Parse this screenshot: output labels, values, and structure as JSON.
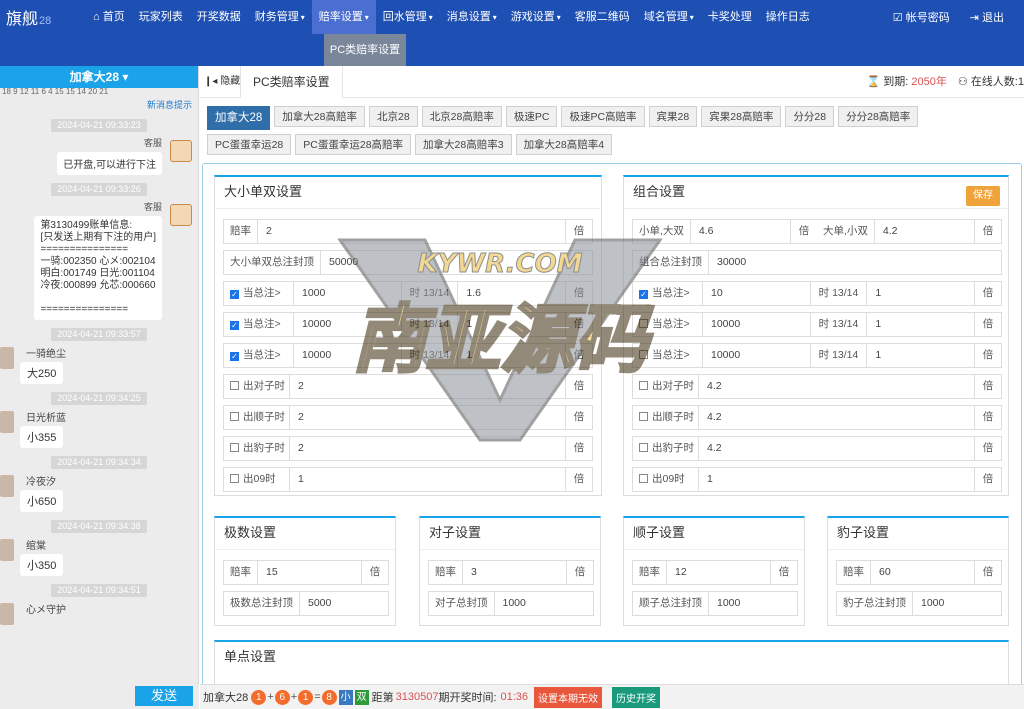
{
  "nav": {
    "logo": "旗舰",
    "logo_sub": "28",
    "items": [
      {
        "label": "首页",
        "icon": "home-icon"
      },
      {
        "label": "玩家列表"
      },
      {
        "label": "开奖数据"
      },
      {
        "label": "财务管理",
        "caret": "▾"
      },
      {
        "label": "赔率设置",
        "caret": "▾",
        "active": true
      },
      {
        "label": "回水管理",
        "caret": "▾"
      },
      {
        "label": "消息设置",
        "caret": "▾"
      },
      {
        "label": "游戏设置",
        "caret": "▾"
      },
      {
        "label": "客服二维码"
      },
      {
        "label": "域名管理",
        "caret": "▾"
      },
      {
        "label": "卡奖处理"
      },
      {
        "label": "操作日志"
      }
    ],
    "account": "帐号密码",
    "logout": "退出"
  },
  "subnav": {
    "item": "PC类赔率设置"
  },
  "chat": {
    "title": "加拿大28 ▾",
    "nums": "18 9 12 11 6 4 15 15 14 20 21",
    "new_msg": "新消息提示",
    "send": "发送",
    "messages": [
      {
        "time": "2024-04-21 09:33:23",
        "side": "r",
        "who": "客服",
        "text": "已开盘,可以进行下注"
      },
      {
        "time": "2024-04-21 09:33:26",
        "side": "r",
        "who": "客服",
        "text": "第3130499账单信息:\n[只发送上期有下注的用户]\n===============\n一骑:002350 心メ:002104\n明白:001749 日光:001104\n冷夜:000899 允芯:000660\n\n==============="
      },
      {
        "time": "2024-04-21 09:33:57",
        "side": "l",
        "who": "一骑绝尘",
        "text": "大250"
      },
      {
        "time": "2024-04-21 09:34:25",
        "side": "l",
        "who": "日光析蓝",
        "text": "小355"
      },
      {
        "time": "2024-04-21 09:34:34",
        "side": "l",
        "who": "冷夜汐",
        "text": "小650"
      },
      {
        "time": "2024-04-21 09:34:38",
        "side": "l",
        "who": "绾棠",
        "text": "小350"
      },
      {
        "time": "2024-04-21 09:34:51",
        "side": "l",
        "who": "心メ守护",
        "text": ""
      }
    ]
  },
  "main": {
    "hide": "隐藏",
    "page_tab": "PC类赔率设置",
    "expire_label": "到期:",
    "expire_value": "2050年",
    "online_label": "在线人数:",
    "online_value": "1",
    "tabs": [
      "加拿大28",
      "加拿大28高赔率",
      "北京28",
      "北京28高赔率",
      "极速PC",
      "极速PC高赔率",
      "宾果28",
      "宾果28高赔率",
      "分分28",
      "分分28高赔率",
      "PC蛋蛋幸运28",
      "PC蛋蛋幸运28高赔率",
      "加拿大28高赔率3",
      "加拿大28高赔率4"
    ],
    "dxds": {
      "title": "大小单双设置",
      "rate_label": "赔率",
      "rate": "2",
      "unit": "倍",
      "cap_label": "大小单双总注封顶",
      "cap": "50000",
      "total_label": "当总注>",
      "time_label": "时 13/14",
      "rows": [
        {
          "checked": true,
          "v": "1000",
          "r": "1.6"
        },
        {
          "checked": true,
          "v": "10000",
          "r": "1"
        },
        {
          "checked": true,
          "v": "10000",
          "r": "1"
        }
      ],
      "extra": [
        {
          "label": "出对子时",
          "v": "2"
        },
        {
          "label": "出顺子时",
          "v": "2"
        },
        {
          "label": "出豹子时",
          "v": "2"
        },
        {
          "label": "出09时",
          "v": "1"
        }
      ]
    },
    "combo": {
      "title": "组合设置",
      "save": "保存",
      "l1": "小单,大双",
      "v1": "4.6",
      "l2": "大单,小双",
      "v2": "4.2",
      "unit": "倍",
      "cap_label": "组合总注封顶",
      "cap": "30000",
      "total_label": "当总注>",
      "time_label": "时 13/14",
      "rows": [
        {
          "checked": true,
          "v": "10",
          "r": "1"
        },
        {
          "checked": false,
          "v": "10000",
          "r": "1"
        },
        {
          "checked": false,
          "v": "10000",
          "r": "1"
        }
      ],
      "extra": [
        {
          "label": "出对子时",
          "v": "4.2"
        },
        {
          "label": "出顺子时",
          "v": "4.2"
        },
        {
          "label": "出豹子时",
          "v": "4.2"
        },
        {
          "label": "出09时",
          "v": "1"
        }
      ]
    },
    "small": [
      {
        "title": "极数设置",
        "rate": "15",
        "cap_label": "极数总注封顶",
        "cap": "5000"
      },
      {
        "title": "对子设置",
        "rate": "3",
        "cap_label": "对子总封顶",
        "cap": "1000"
      },
      {
        "title": "顺子设置",
        "rate": "12",
        "cap_label": "顺子总注封顶",
        "cap": "1000"
      },
      {
        "title": "豹子设置",
        "rate": "60",
        "cap_label": "豹子总注封顶",
        "cap": "1000"
      }
    ],
    "single": {
      "title": "单点设置"
    }
  },
  "bottom": {
    "game": "加拿大28",
    "b1": "1",
    "b2": "6",
    "b3": "1",
    "sum": "8",
    "s1": "小",
    "s2": "双",
    "dist_label": "距第",
    "issue": "3130507",
    "period_label": "期开奖时间:",
    "time": "01:36",
    "btn1": "设置本期无效",
    "btn2": "历史开奖"
  },
  "watermark": {
    "top": "KYWR.COM",
    "main": "南亚源码"
  },
  "colors": {
    "nav": "#1e4fb2",
    "accent": "#1aa3e8",
    "ball": "#f36c2b",
    "small": "#3a78c2",
    "double": "#2e9a3a"
  }
}
